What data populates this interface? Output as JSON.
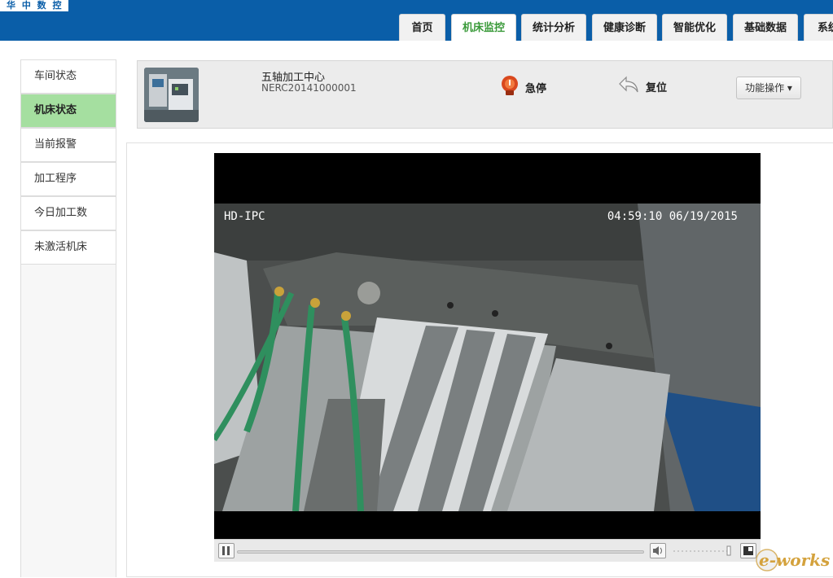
{
  "header": {
    "logo_text": "华 中 数 控",
    "tabs": [
      {
        "label": "首页",
        "active": false
      },
      {
        "label": "机床监控",
        "active": true
      },
      {
        "label": "统计分析",
        "active": false
      },
      {
        "label": "健康诊断",
        "active": false
      },
      {
        "label": "智能优化",
        "active": false
      },
      {
        "label": "基础数据",
        "active": false
      },
      {
        "label": "系统",
        "active": false
      }
    ]
  },
  "sidebar": {
    "items": [
      {
        "label": "车间状态",
        "active": false
      },
      {
        "label": "机床状态",
        "active": true
      },
      {
        "label": "当前报警",
        "active": false
      },
      {
        "label": "加工程序",
        "active": false
      },
      {
        "label": "今日加工数",
        "active": false
      },
      {
        "label": "未激活机床",
        "active": false
      }
    ]
  },
  "machine": {
    "name": "五轴加工中心",
    "id": "NERC20141000001",
    "estop_label": "急停",
    "reset_label": "复位",
    "function_button": "功能操作 ▾"
  },
  "video": {
    "camera_label": "HD-IPC",
    "timestamp": "04:59:10 06/19/2015"
  },
  "watermark": {
    "text": "e-works"
  },
  "colors": {
    "header_blue": "#0a5ea8",
    "active_tab_text": "#3a9a3a",
    "active_sidebar_bg": "#a5dfa0"
  }
}
